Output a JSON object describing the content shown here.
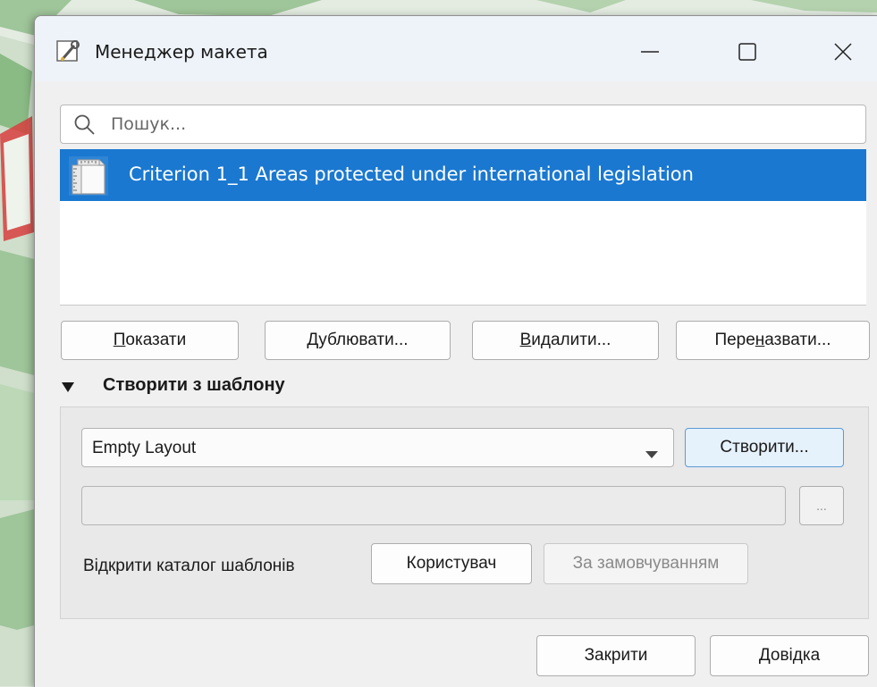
{
  "window": {
    "title": "Менеджер макета",
    "controls": {
      "minimize": "—",
      "maximize": "☐",
      "close": "✕"
    }
  },
  "search": {
    "placeholder": "Пошук..."
  },
  "layouts": [
    {
      "name": "Criterion 1_1 Areas protected under international legislation",
      "selected": true
    }
  ],
  "actions": {
    "show": {
      "pre": "",
      "u": "П",
      "post": "оказати"
    },
    "duplicate": {
      "pre": "",
      "u": "Д",
      "post": "ублювати..."
    },
    "delete": {
      "pre": "",
      "u": "В",
      "post": "идалити..."
    },
    "rename": {
      "pre": "Пере",
      "u": "н",
      "post": "азвати..."
    }
  },
  "template_section": {
    "title": "Створити з шаблону",
    "expanded": true,
    "template_select": "Empty Layout",
    "create_label": "Створити...",
    "path_value": "",
    "browse_label": "...",
    "open_dir_label": "Відкрити каталог шаблонів",
    "user_label": "Користувач",
    "default_label": "За замовчуванням"
  },
  "footer": {
    "close_label": "Закрити",
    "help_label": "Довідка"
  },
  "colors": {
    "selection": "#1a78d0",
    "titlebar": "#eef3f9",
    "dialog_bg": "#f0f0f0"
  }
}
